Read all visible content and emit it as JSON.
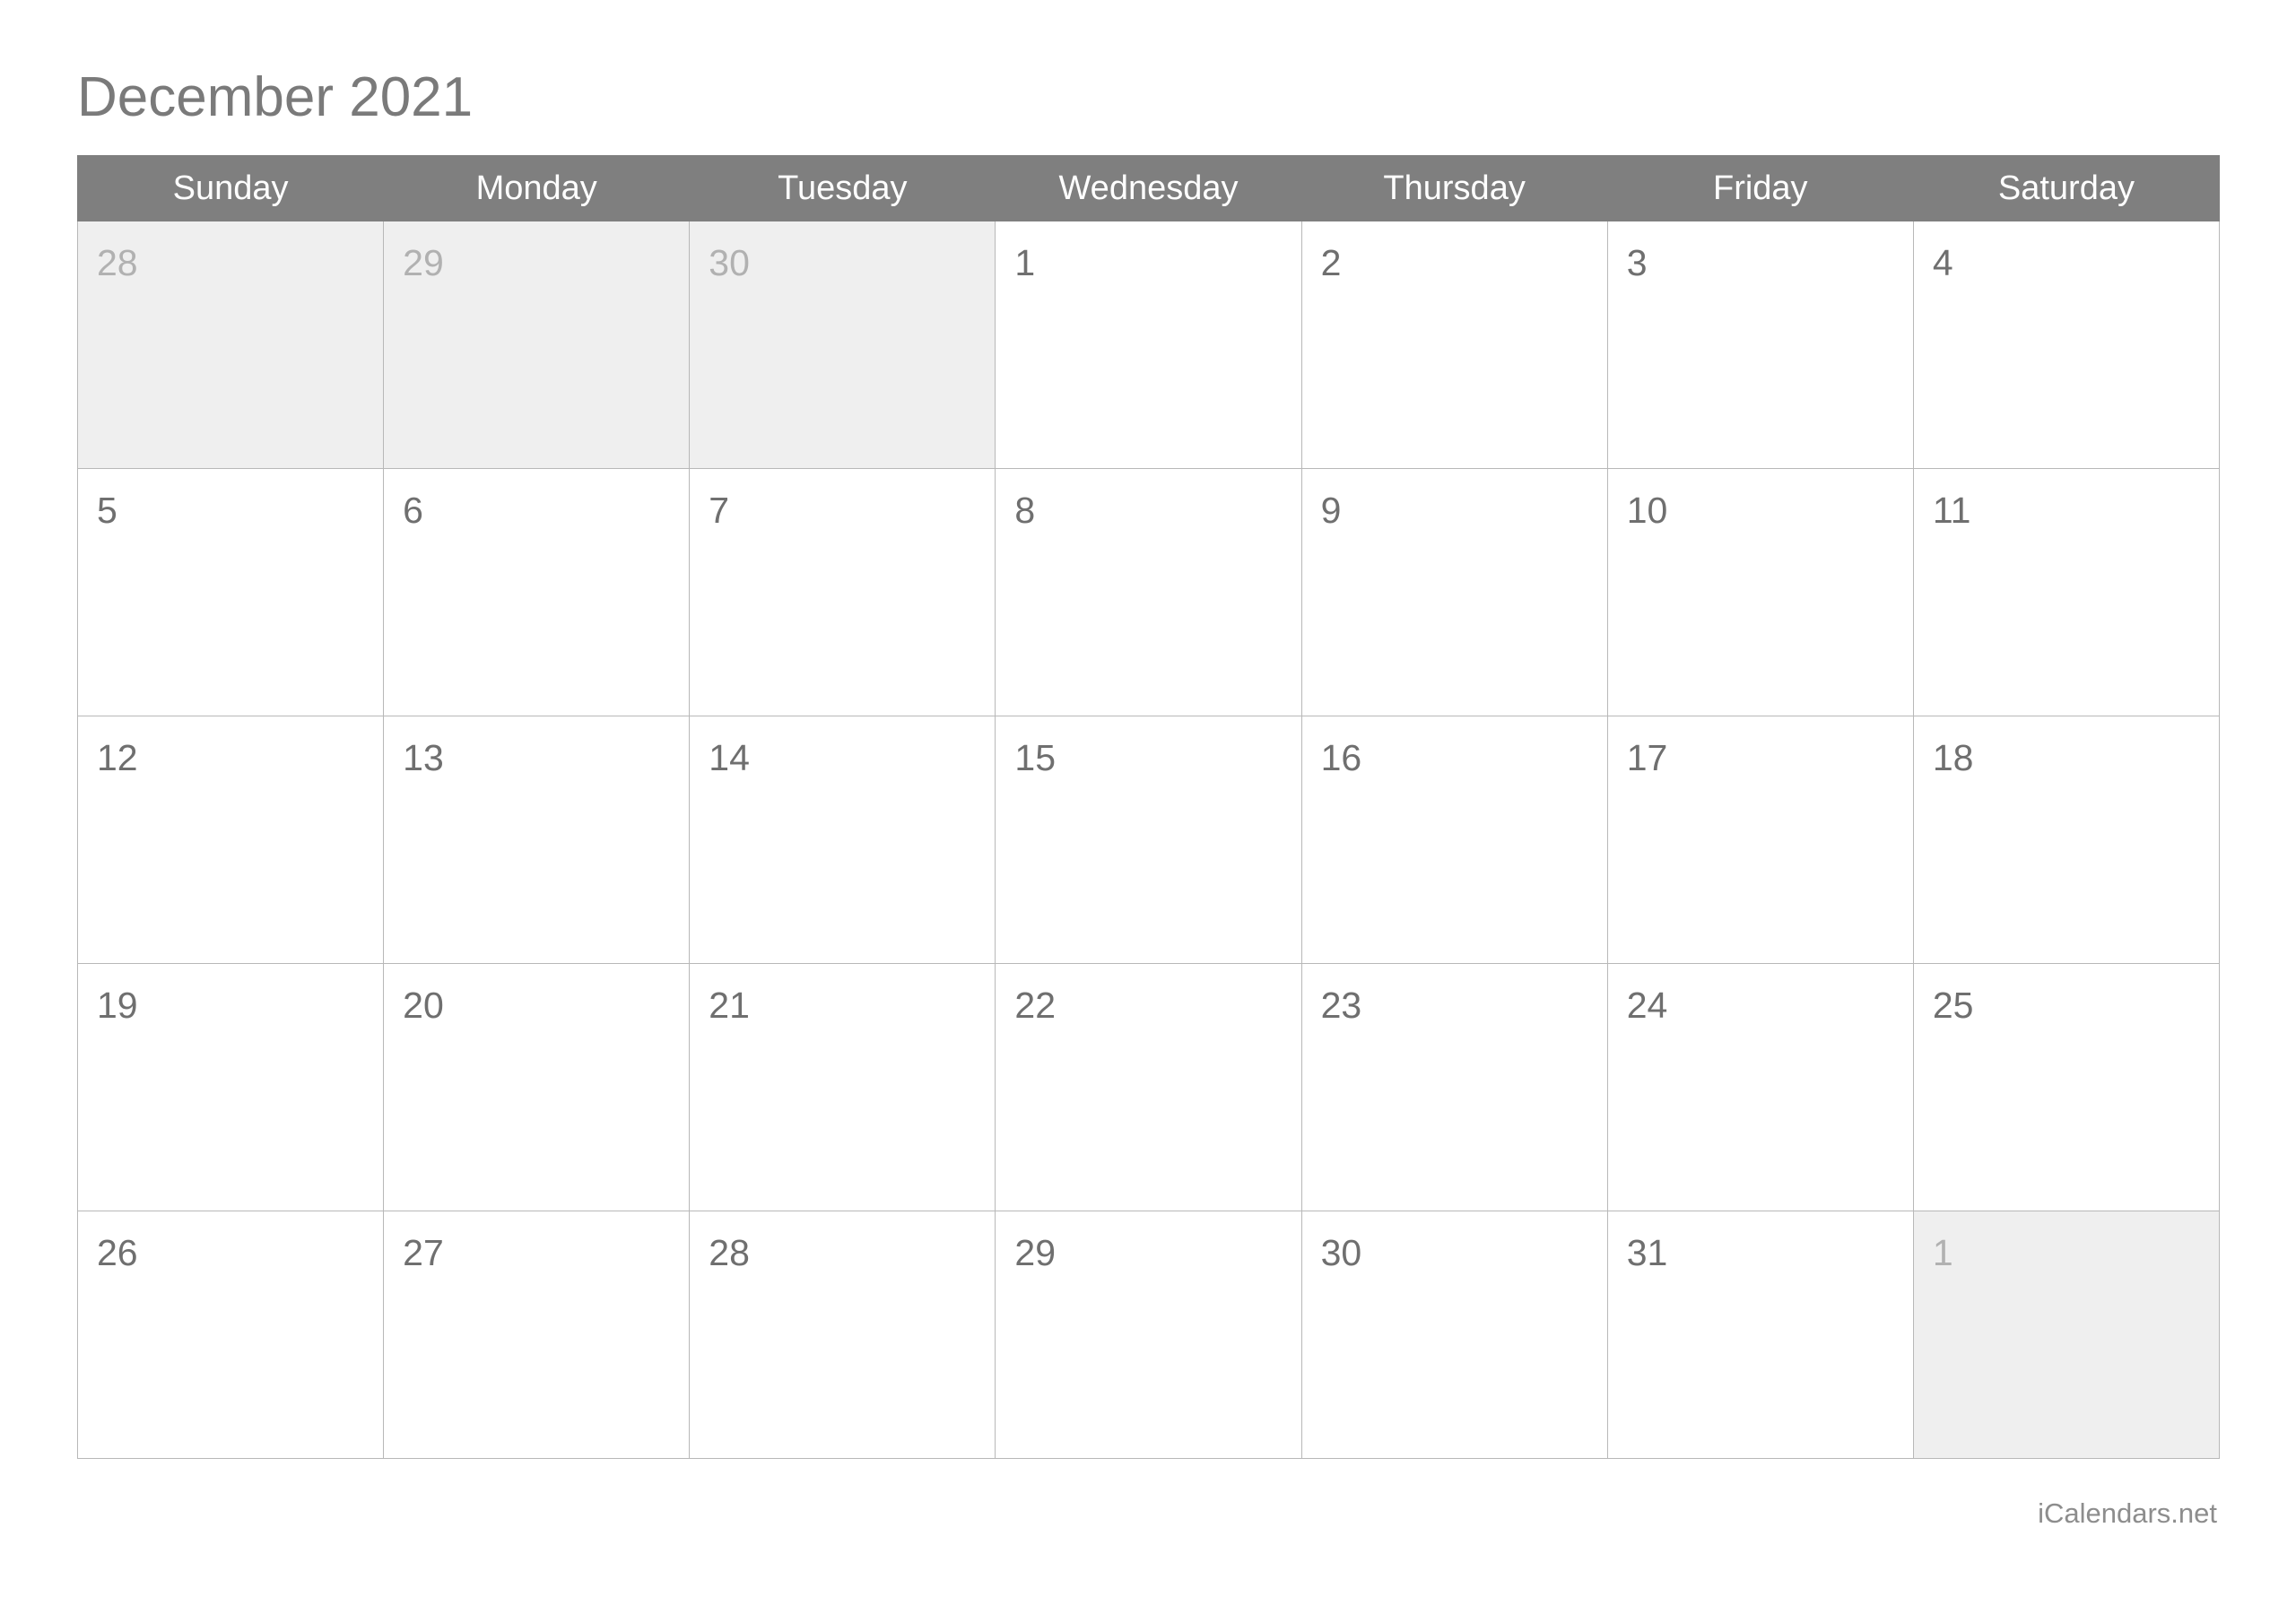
{
  "title": "December 2021",
  "footer": "iCalendars.net",
  "colors": {
    "header_background": "#7f7f7f",
    "header_text": "#ffffff",
    "title_text": "#7a7a7a",
    "in_month_number": "#6f6f6f",
    "out_month_number": "#b1b1b1",
    "out_month_cell_background": "#efefef",
    "cell_background": "#ffffff",
    "grid_line": "#b8b8b8",
    "footer_text": "#8d8d8d"
  },
  "weekday_headers": [
    "Sunday",
    "Monday",
    "Tuesday",
    "Wednesday",
    "Thursday",
    "Friday",
    "Saturday"
  ],
  "weeks": [
    [
      {
        "day": "28",
        "in_month": false
      },
      {
        "day": "29",
        "in_month": false
      },
      {
        "day": "30",
        "in_month": false
      },
      {
        "day": "1",
        "in_month": true
      },
      {
        "day": "2",
        "in_month": true
      },
      {
        "day": "3",
        "in_month": true
      },
      {
        "day": "4",
        "in_month": true
      }
    ],
    [
      {
        "day": "5",
        "in_month": true
      },
      {
        "day": "6",
        "in_month": true
      },
      {
        "day": "7",
        "in_month": true
      },
      {
        "day": "8",
        "in_month": true
      },
      {
        "day": "9",
        "in_month": true
      },
      {
        "day": "10",
        "in_month": true
      },
      {
        "day": "11",
        "in_month": true
      }
    ],
    [
      {
        "day": "12",
        "in_month": true
      },
      {
        "day": "13",
        "in_month": true
      },
      {
        "day": "14",
        "in_month": true
      },
      {
        "day": "15",
        "in_month": true
      },
      {
        "day": "16",
        "in_month": true
      },
      {
        "day": "17",
        "in_month": true
      },
      {
        "day": "18",
        "in_month": true
      }
    ],
    [
      {
        "day": "19",
        "in_month": true
      },
      {
        "day": "20",
        "in_month": true
      },
      {
        "day": "21",
        "in_month": true
      },
      {
        "day": "22",
        "in_month": true
      },
      {
        "day": "23",
        "in_month": true
      },
      {
        "day": "24",
        "in_month": true
      },
      {
        "day": "25",
        "in_month": true
      }
    ],
    [
      {
        "day": "26",
        "in_month": true
      },
      {
        "day": "27",
        "in_month": true
      },
      {
        "day": "28",
        "in_month": true
      },
      {
        "day": "29",
        "in_month": true
      },
      {
        "day": "30",
        "in_month": true
      },
      {
        "day": "31",
        "in_month": true
      },
      {
        "day": "1",
        "in_month": false
      }
    ]
  ]
}
